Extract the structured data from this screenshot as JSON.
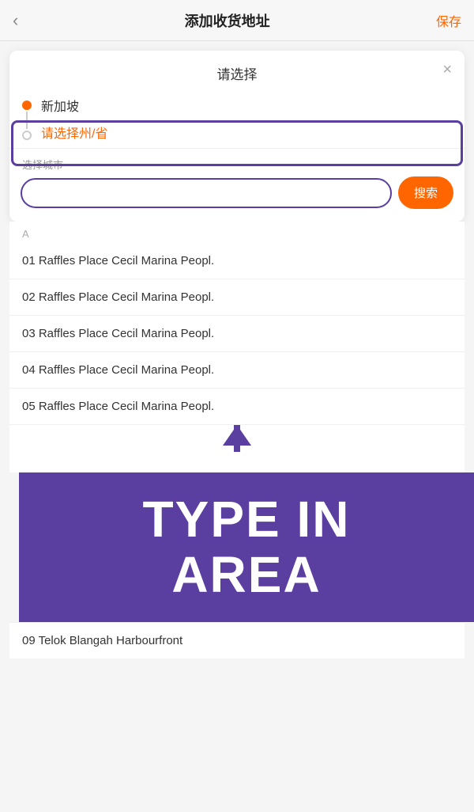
{
  "nav": {
    "back_icon": "‹",
    "title": "添加收货地址",
    "save_label": "保存"
  },
  "modal": {
    "title": "请选择",
    "close_icon": "×"
  },
  "location": {
    "country": "新加坡",
    "province_placeholder": "请选择州/省"
  },
  "search": {
    "label": "选择城市",
    "input_placeholder": "",
    "button_label": "搜索"
  },
  "list": {
    "section_label": "A",
    "items": [
      "01  Raffles  Place  Cecil  Marina  Peopl.",
      "02  Raffles  Place  Cecil  Marina  Peopl.",
      "03  Raffles  Place  Cecil  Marina  Peopl.",
      "04  Raffles  Place  Cecil  Marina  Peopl.",
      "05  Raffles  Place  Cecil  Marina  Peopl."
    ]
  },
  "annotation": {
    "type_in_line1": "TYPE IN",
    "type_in_line2": "AREA"
  },
  "bottom": {
    "item": "09  Telok Blangah  Harbourfront"
  }
}
